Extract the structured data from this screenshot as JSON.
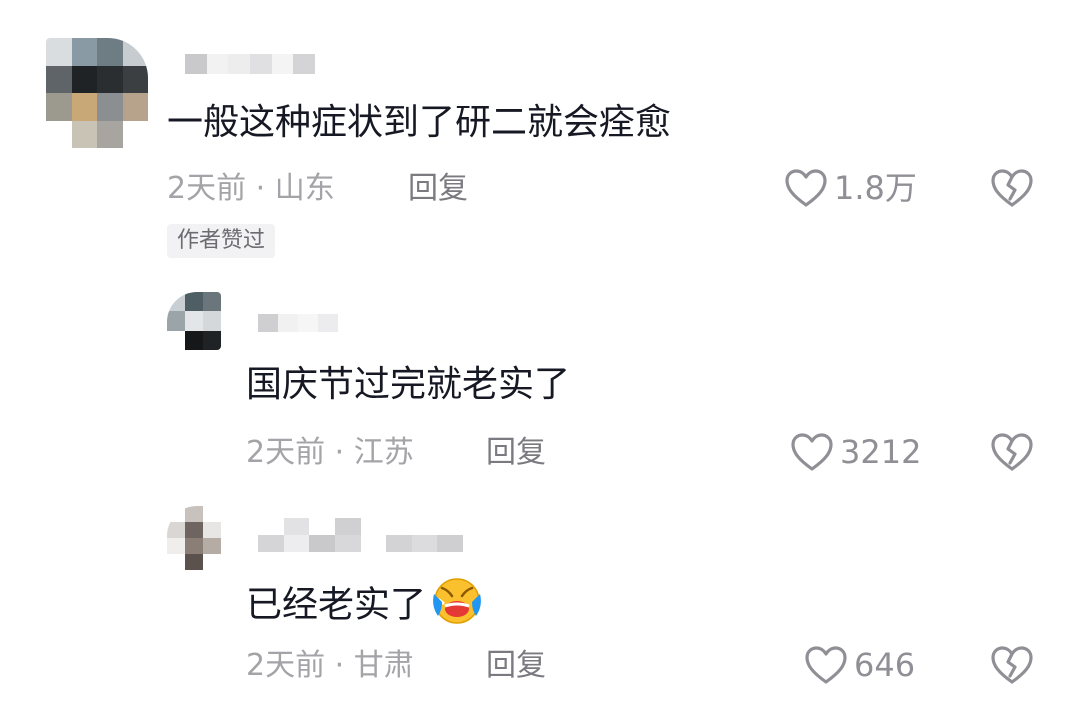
{
  "comments": [
    {
      "text": "一般这种症状到了研二就会痊愈",
      "meta": "2天前 · 山东",
      "reply_label": "回复",
      "likes": "1.8万",
      "badge": "作者赞过"
    },
    {
      "text": "国庆节过完就老实了",
      "meta": "2天前 · 江苏",
      "reply_label": "回复",
      "likes": "3212"
    },
    {
      "text": "已经老实了",
      "emoji": "crying-laughing-emoji",
      "meta": "2天前 · 甘肃",
      "reply_label": "回复",
      "likes": "646"
    }
  ],
  "colors": {
    "text_primary": "#161823",
    "text_meta": "#a4a4a8",
    "icon_gray": "#8f8f95",
    "badge_bg": "#f2f2f4",
    "emoji_yellow": "#fbc02d",
    "emoji_blue": "#2196f3"
  }
}
